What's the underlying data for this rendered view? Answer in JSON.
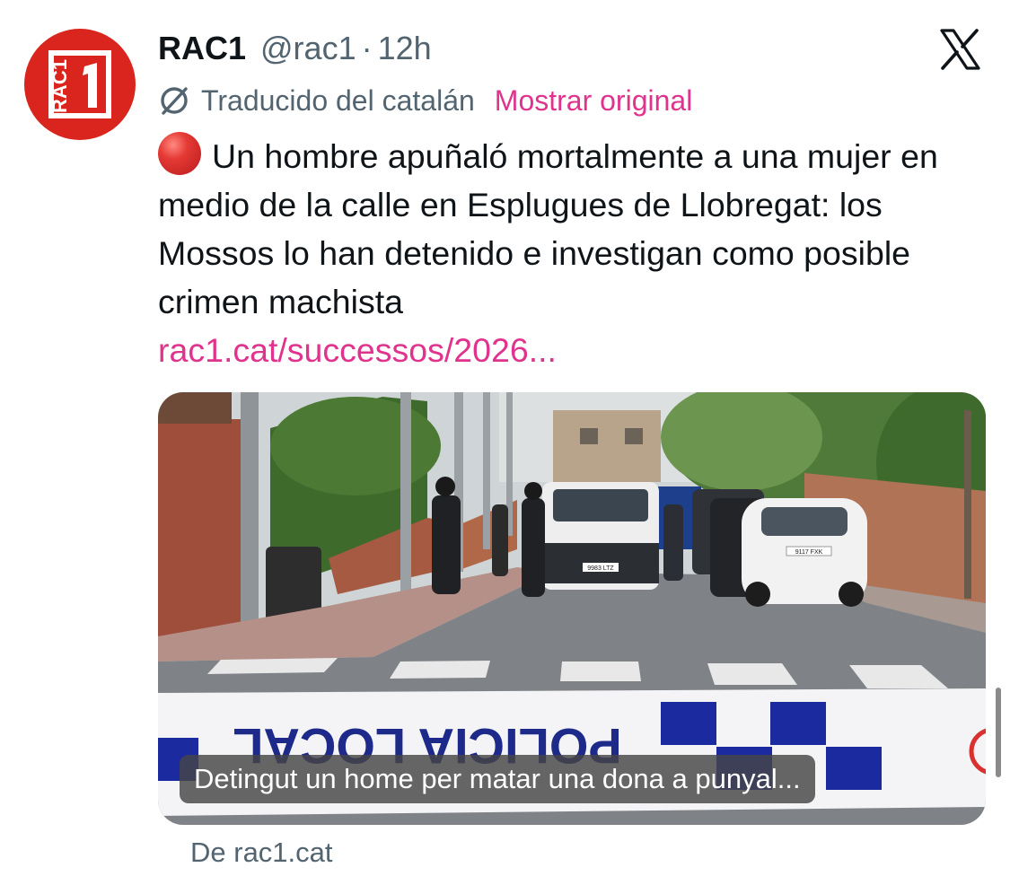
{
  "author": {
    "name": "RAC1",
    "handle": "@rac1",
    "separator": "·",
    "time": "12h",
    "avatar_text": "RAC1",
    "avatar_color": "#d9251d"
  },
  "translation": {
    "label": "Traducido del catalán",
    "show_original": "Mostrar original",
    "icon": "translate-icon"
  },
  "tweet": {
    "emoji": "red-circle",
    "text": "Un hombre apuñaló mortalmente a una mujer en medio de la calle en Esplugues de Llobregat: los Mossos lo han detenido e investigan como posible crimen machista",
    "link": "rac1.cat/successos/2026..."
  },
  "card": {
    "caption": "Detingut un home per matar una dona a punyal...",
    "tape_text": "POLICIA LOCAL",
    "van_plate": "9983 LTZ",
    "car_plate": "9117 FXK",
    "source": "De rac1.cat"
  },
  "colors": {
    "link": "#e0338e",
    "muted": "#536471",
    "text": "#0f1419"
  }
}
